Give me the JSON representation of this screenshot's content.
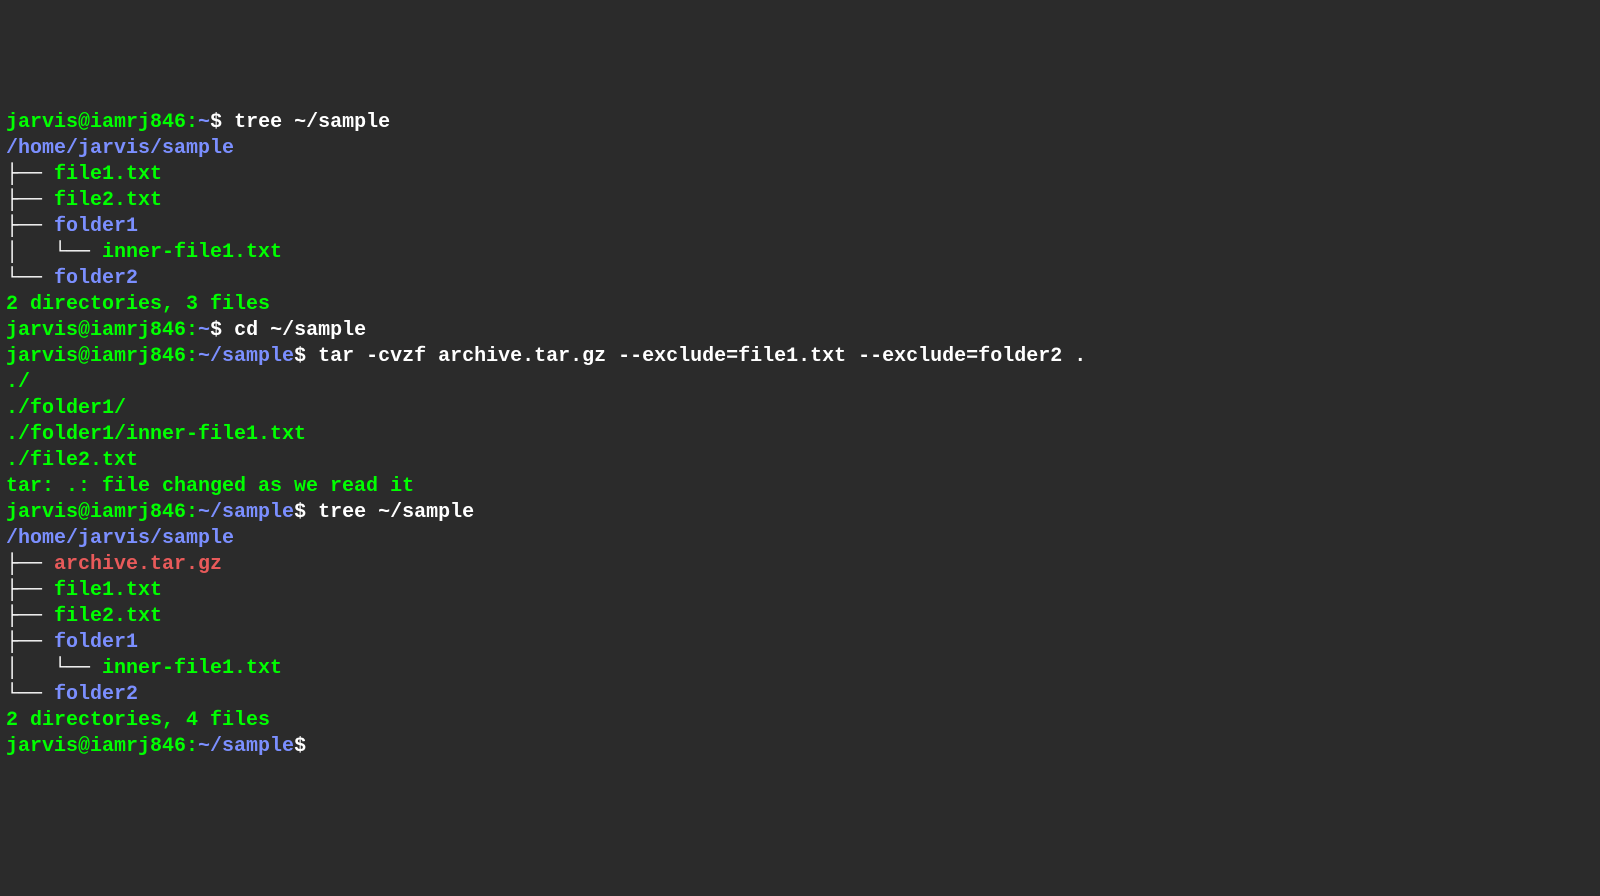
{
  "session": {
    "line01": {
      "prompt_user": "jarvis@iamrj846",
      "prompt_sep": ":",
      "prompt_path": "~",
      "prompt_dollar": "$ ",
      "cmd": "tree ~/sample"
    },
    "line02_path": "/home/jarvis/sample",
    "tree1": {
      "b1": "├── ",
      "f1": "file1.txt",
      "b2": "├── ",
      "f2": "file2.txt",
      "b3": "├── ",
      "d1": "folder1",
      "b4": "│   └── ",
      "f3": "inner-file1.txt",
      "b5": "└── ",
      "d2": "folder2"
    },
    "blank1": "",
    "summary1": "2 directories, 3 files",
    "line03": {
      "prompt_user": "jarvis@iamrj846",
      "prompt_sep": ":",
      "prompt_path": "~",
      "prompt_dollar": "$ ",
      "cmd": "cd ~/sample"
    },
    "line04": {
      "prompt_user": "jarvis@iamrj846",
      "prompt_sep": ":",
      "prompt_path": "~/sample",
      "prompt_dollar": "$ ",
      "cmd": "tar -cvzf archive.tar.gz --exclude=file1.txt --exclude=folder2 ."
    },
    "tar_out": {
      "o1": "./",
      "o2": "./folder1/",
      "o3": "./folder1/inner-file1.txt",
      "o4": "./file2.txt",
      "o5": "tar: .: file changed as we read it"
    },
    "line05": {
      "prompt_user": "jarvis@iamrj846",
      "prompt_sep": ":",
      "prompt_path": "~/sample",
      "prompt_dollar": "$ ",
      "cmd": "tree ~/sample"
    },
    "line06_path": "/home/jarvis/sample",
    "tree2": {
      "b1": "├── ",
      "a1": "archive.tar.gz",
      "b2": "├── ",
      "f1": "file1.txt",
      "b3": "├── ",
      "f2": "file2.txt",
      "b4": "├── ",
      "d1": "folder1",
      "b5": "│   └── ",
      "f3": "inner-file1.txt",
      "b6": "└── ",
      "d2": "folder2"
    },
    "blank2": "",
    "summary2": "2 directories, 4 files",
    "line07": {
      "prompt_user": "jarvis@iamrj846",
      "prompt_sep": ":",
      "prompt_path": "~/sample",
      "prompt_dollar": "$ ",
      "cmd": ""
    }
  }
}
